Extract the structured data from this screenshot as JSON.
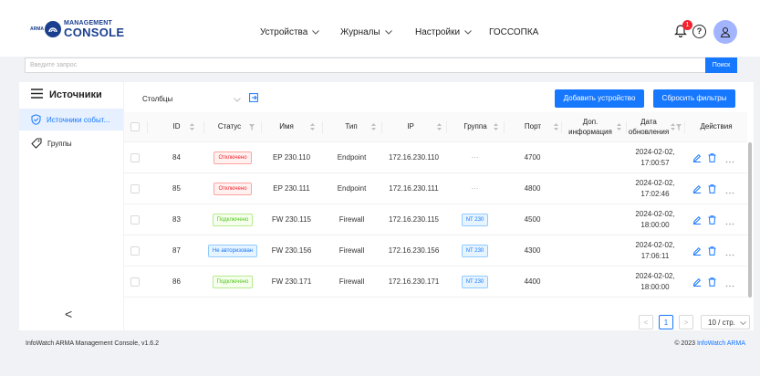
{
  "header": {
    "logo": {
      "badge": "ARMA",
      "line1": "MANAGEMENT",
      "line2": "CONSOLE"
    },
    "nav": [
      {
        "label": "Устройства",
        "dropdown": true
      },
      {
        "label": "Журналы",
        "dropdown": true
      },
      {
        "label": "Настройки",
        "dropdown": true
      },
      {
        "label": "ГОССОПКА",
        "dropdown": false
      }
    ],
    "notifications_count": "1",
    "help_symbol": "?",
    "icons": [
      "bell-icon",
      "help-icon",
      "user-icon"
    ],
    "colors": {
      "avatar": "#a3b4ff",
      "badge": "#f5222d",
      "brand": "#1b3f8f"
    }
  },
  "search": {
    "placeholder": "Введите запрос",
    "value": "",
    "button_label": "Поиск"
  },
  "sidebar": {
    "title": "Источники",
    "items": [
      {
        "label": "Источники событ...",
        "icon": "shield-icon",
        "active": true
      },
      {
        "label": "Группы",
        "icon": "tag-icon",
        "active": false
      }
    ],
    "collapse_symbol": "<"
  },
  "toolbar": {
    "columns_label": "Столбцы",
    "add_device_label": "Добавить устройство",
    "reset_filters_label": "Сбросить фильтры"
  },
  "table": {
    "columns": [
      "ID",
      "Статус",
      "Имя",
      "Тип",
      "IP",
      "Группа",
      "Порт",
      "Доп. информация",
      "Дата обновления",
      "Действия"
    ],
    "rows": [
      {
        "id": "84",
        "status": "Отключено",
        "status_kind": "red",
        "name": "EP 230.110",
        "type": "Endpoint",
        "ip": "172.16.230.110",
        "group": "···",
        "group_kind": "text",
        "port": "4700",
        "extra": "",
        "date": "2024-02-02,",
        "time": "17:00:57"
      },
      {
        "id": "85",
        "status": "Отключено",
        "status_kind": "red",
        "name": "EP 230.111",
        "type": "Endpoint",
        "ip": "172.16.230.111",
        "group": "···",
        "group_kind": "text",
        "port": "4800",
        "extra": "",
        "date": "2024-02-02,",
        "time": "17:02:46"
      },
      {
        "id": "83",
        "status": "Подключено",
        "status_kind": "green",
        "name": "FW 230.115",
        "type": "Firewall",
        "ip": "172.16.230.115",
        "group": "NT 230",
        "group_kind": "tag",
        "port": "4500",
        "extra": "",
        "date": "2024-02-02,",
        "time": "18:00:00"
      },
      {
        "id": "87",
        "status": "Не авторизован",
        "status_kind": "blue",
        "name": "FW 230.156",
        "type": "Firewall",
        "ip": "172.16.230.156",
        "group": "NT 230",
        "group_kind": "tag",
        "port": "4300",
        "extra": "",
        "date": "2024-02-02,",
        "time": "17:06:11"
      },
      {
        "id": "86",
        "status": "Подключено",
        "status_kind": "green",
        "name": "FW 230.171",
        "type": "Firewall",
        "ip": "172.16.230.171",
        "group": "NT 230",
        "group_kind": "tag",
        "port": "4400",
        "extra": "",
        "date": "2024-02-02,",
        "time": "18:00:00"
      }
    ],
    "row_actions": [
      "edit-icon",
      "delete-icon",
      "more-icon"
    ]
  },
  "pagination": {
    "prev": "<",
    "current": "1",
    "next": ">",
    "page_size": "10 / стр."
  },
  "footer": {
    "left": "InfoWatch ARMA Management Console, v1.6.2",
    "copyright": "© 2023 ",
    "link": "InfoWatch ARMA"
  }
}
